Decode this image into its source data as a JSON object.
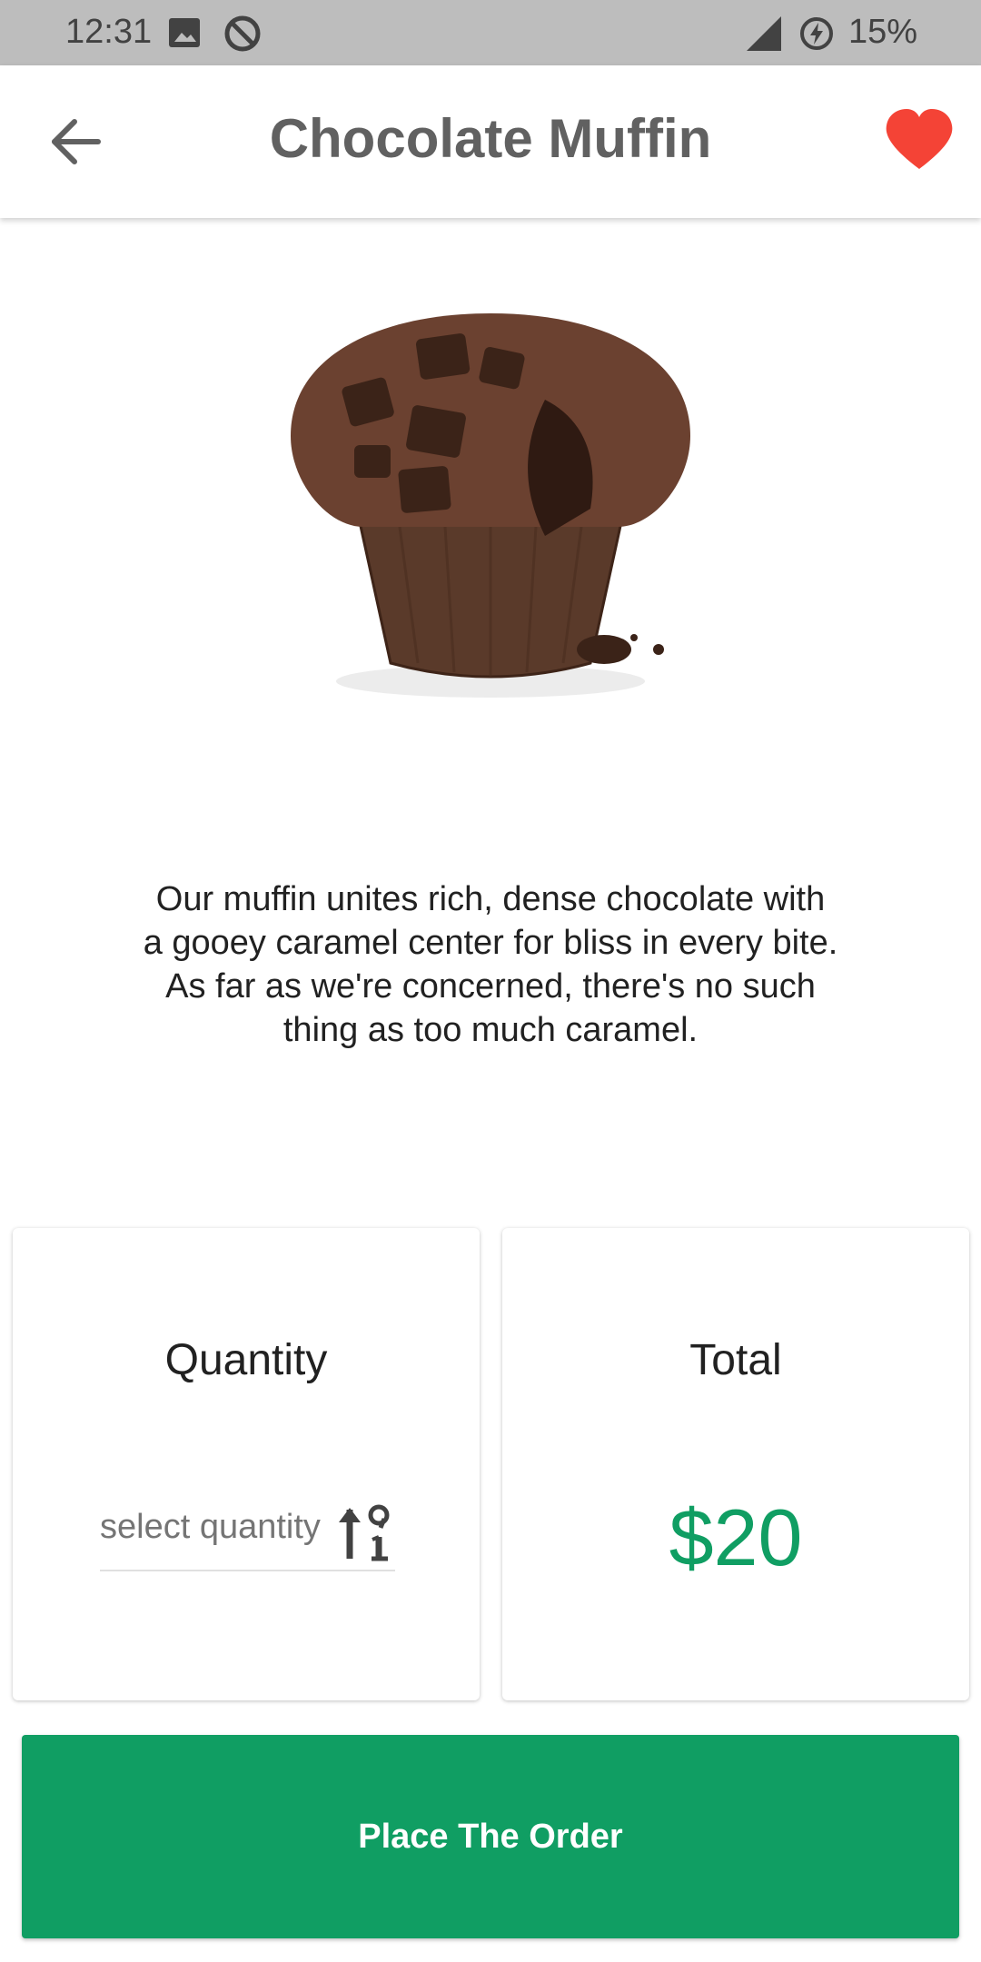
{
  "status_bar": {
    "time": "12:31",
    "battery": "15%",
    "icons": [
      "image-icon",
      "no-disturb-icon",
      "signal-icon",
      "battery-saver-icon"
    ]
  },
  "app_bar": {
    "title": "Chocolate Muffin",
    "back_icon": "arrow-left-icon",
    "favorite_icon": "heart-icon",
    "favorite_color": "#f44336"
  },
  "product": {
    "image_alt": "chocolate-muffin",
    "description": "Our muffin unites rich, dense chocolate with\na gooey caramel center for bliss in every bite.\nAs far as we're concerned, there's no such\nthing as too much caramel."
  },
  "quantity_card": {
    "title": "Quantity",
    "placeholder": "select quantity",
    "icon": "sort-numeric-icon"
  },
  "total_card": {
    "title": "Total",
    "value": "$20"
  },
  "order_button": {
    "label": "Place The Order"
  },
  "colors": {
    "accent": "#109e63",
    "status_bar": "#bdbdbd",
    "heart": "#f44336"
  }
}
